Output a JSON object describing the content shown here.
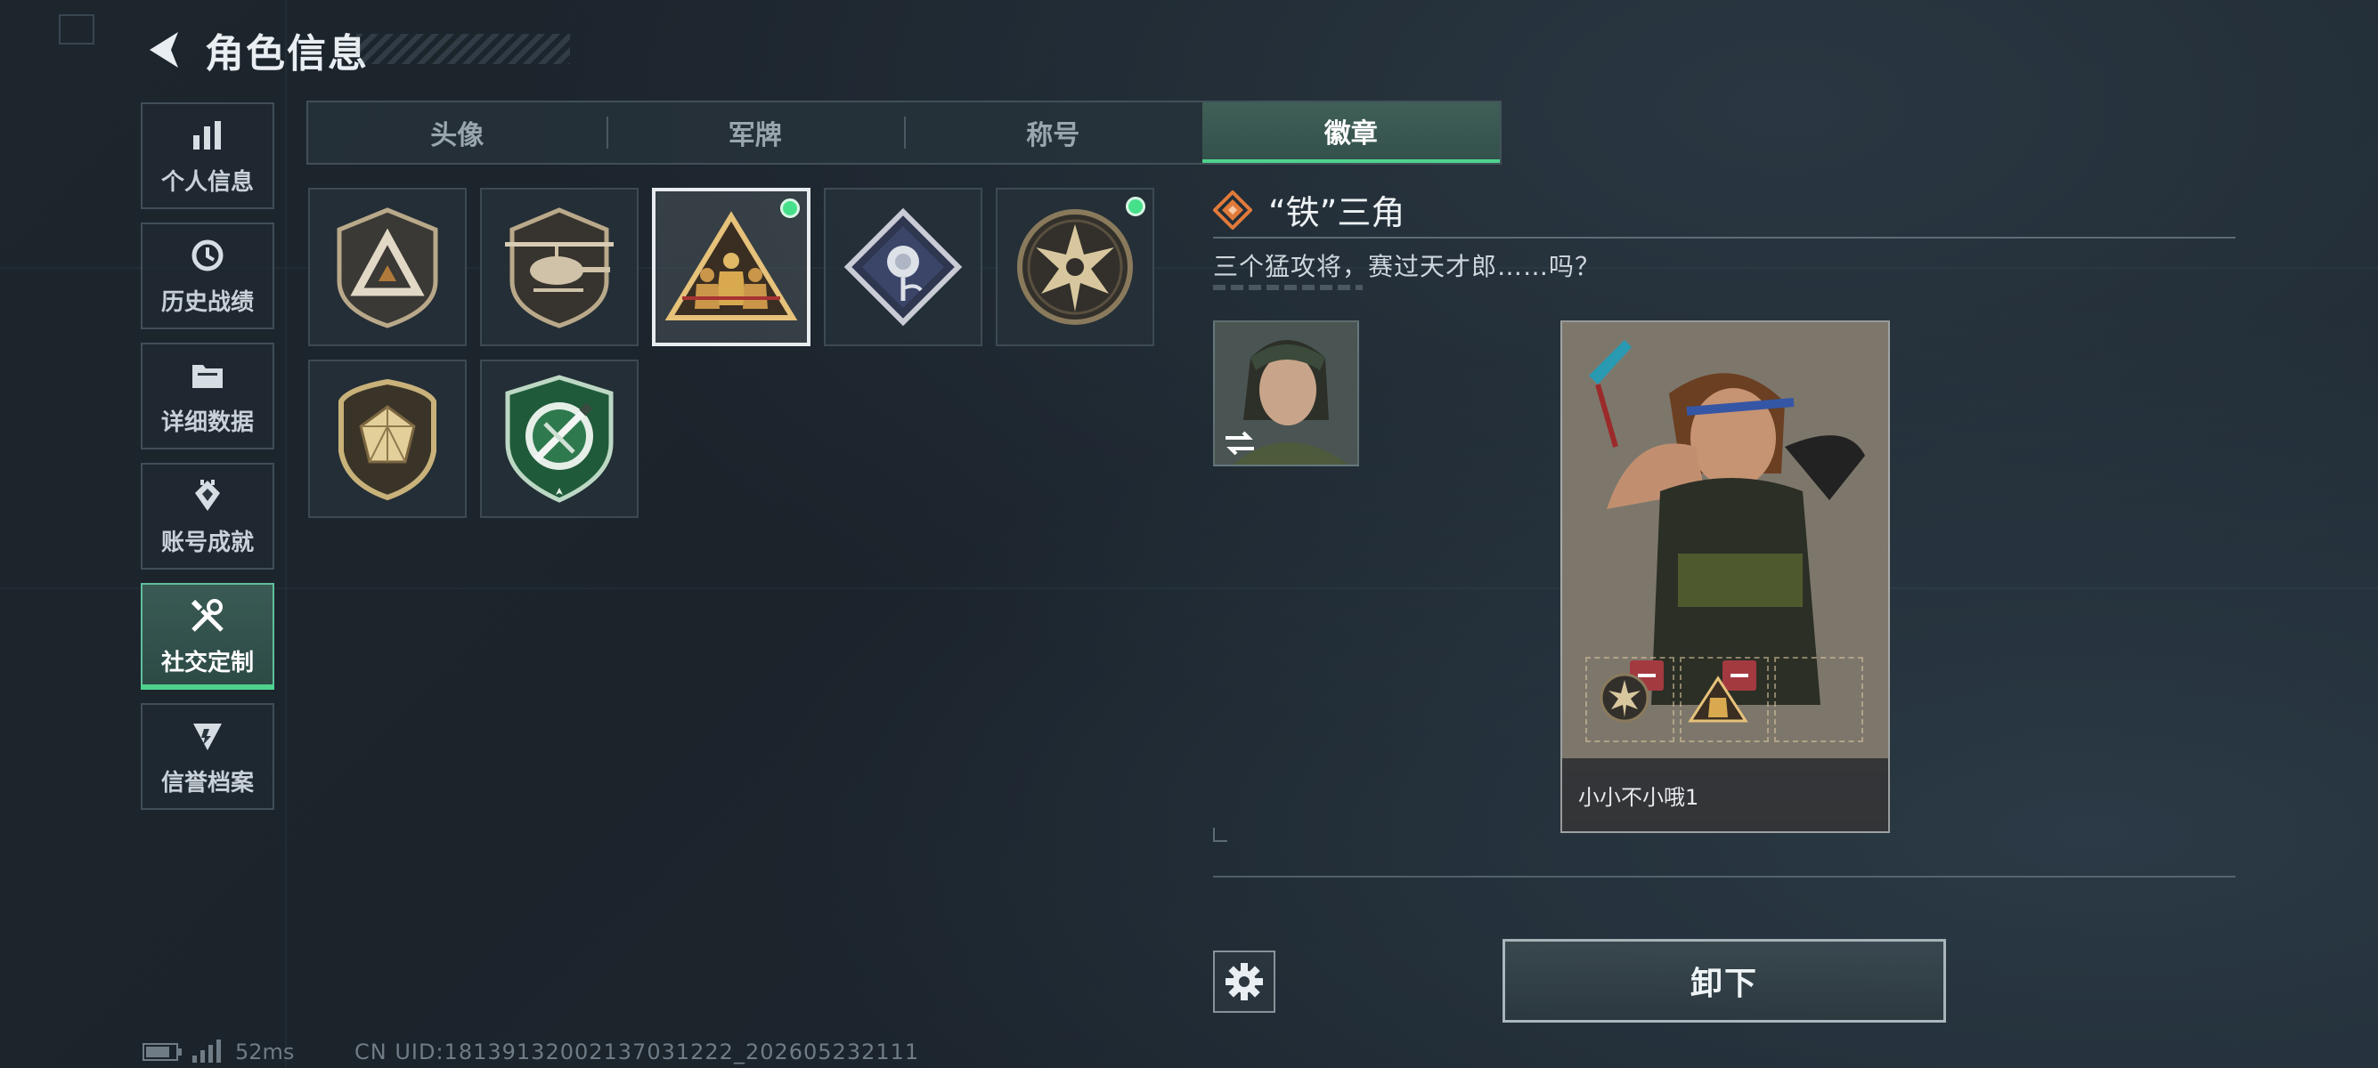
{
  "header": {
    "title": "角色信息"
  },
  "sidebar": {
    "items": [
      {
        "label": "个人信息",
        "icon": "bar-chart-icon"
      },
      {
        "label": "历史战绩",
        "icon": "history-clock-icon"
      },
      {
        "label": "详细数据",
        "icon": "folder-icon"
      },
      {
        "label": "账号成就",
        "icon": "achievement-icon"
      },
      {
        "label": "社交定制",
        "icon": "tools-icon",
        "active": true
      },
      {
        "label": "信誉档案",
        "icon": "reputation-icon"
      }
    ]
  },
  "tabs": [
    {
      "label": "头像"
    },
    {
      "label": "军牌"
    },
    {
      "label": "称号"
    },
    {
      "label": "徽章",
      "active": true
    }
  ],
  "badges": [
    {
      "icon": "delta-shield-badge-icon",
      "equipped": false,
      "selected": false
    },
    {
      "icon": "helicopter-badge-icon",
      "equipped": false,
      "selected": false
    },
    {
      "icon": "squad-triangle-badge-icon",
      "equipped": true,
      "selected": true
    },
    {
      "icon": "rose-diamond-badge-icon",
      "equipped": false,
      "selected": false
    },
    {
      "icon": "star-circle-badge-icon",
      "equipped": true,
      "selected": false
    },
    {
      "icon": "gem-shield-badge-icon",
      "equipped": false,
      "selected": false
    },
    {
      "icon": "green-crossed-knives-badge-icon",
      "equipped": false,
      "selected": false
    }
  ],
  "detail": {
    "name": "“铁”三角",
    "description": "三个猛攻将，赛过天才郎……吗？"
  },
  "preview": {
    "player_name": "小小不小哦1"
  },
  "actions": {
    "unequip_label": "卸下"
  },
  "status": {
    "ping": "52ms",
    "uid": "CN UID:1813913200213703122​2_202605232111"
  },
  "colors": {
    "accent_green": "#4fd28e",
    "selected_tab": "#3f5f57",
    "minus_red": "#a33a40",
    "rarity_orange": "#e07a3a"
  }
}
